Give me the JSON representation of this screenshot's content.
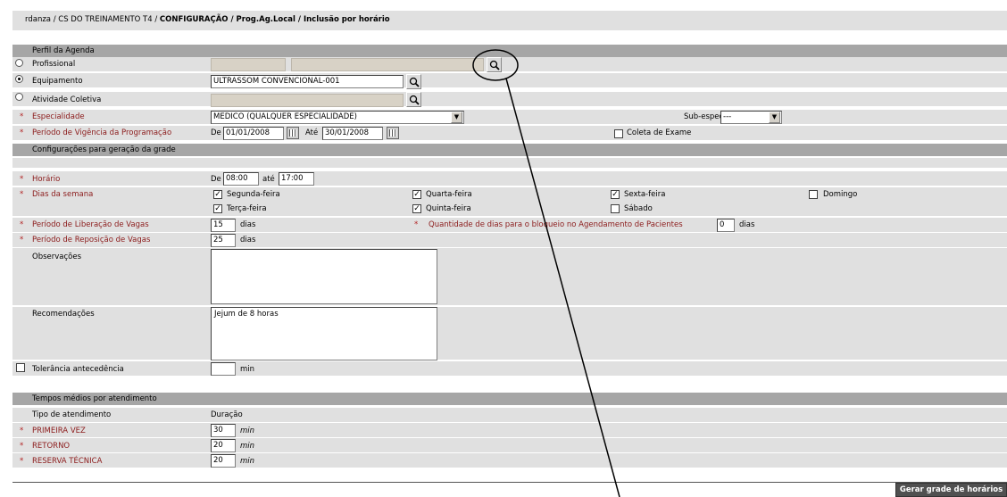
{
  "breadcrumb": {
    "path": "rdanza / CS DO TREINAMENTO T4 / ",
    "current": "CONFIGURAÇÃO / Prog.Ag.Local / Inclusão por horário"
  },
  "perfil": {
    "header": "Perfil da Agenda",
    "profissional_label": "Profissional",
    "equipamento_label": "Equipamento",
    "equipamento_value": "ULTRASSOM CONVENCIONAL-001",
    "atividade_label": "Atividade Coletiva",
    "especialidade_label": "Especialidade",
    "especialidade_value": "MEDICO (QUALQUER ESPECIALIDADE)",
    "subespecial_label": "Sub-especial.",
    "subespecial_value": "---",
    "periodo_label": "Período de Vigência da Programação",
    "de_label": "De",
    "de_value": "01/01/2008",
    "ate_label": "Até",
    "ate_value": "30/01/2008",
    "coleta_label": "Coleta de Exame",
    "selected_radio": "Equipamento"
  },
  "config": {
    "header": "Configurações para geração da grade",
    "horario_label": "Horário",
    "horario_de_label": "De",
    "horario_de": "08:00",
    "horario_ate_label": "até",
    "horario_ate": "17:00",
    "dias_label": "Dias da semana",
    "days": {
      "segunda": "Segunda-feira",
      "terca": "Terça-feira",
      "quarta": "Quarta-feira",
      "quinta": "Quinta-feira",
      "sexta": "Sexta-feira",
      "sabado": "Sábado",
      "domingo": "Domingo"
    },
    "liberacao_label": "Período de Liberação de Vagas",
    "liberacao_value": "15",
    "dias_unit": "dias",
    "bloqueio_label": "Quantidade de dias para o bloqueio no Agendamento de Pacientes",
    "bloqueio_value": "0",
    "reposicao_label": "Período de Reposição de Vagas",
    "reposicao_value": "25",
    "observacoes_label": "Observações",
    "observacoes_value": "",
    "recomendacoes_label": "Recomendações",
    "recomendacoes_value": "Jejum de 8 horas",
    "tolerancia_label": "Tolerância antecedência",
    "tolerancia_value": "",
    "min_unit": "min"
  },
  "tempos": {
    "header": "Tempos médios por atendimento",
    "col_tipo": "Tipo de atendimento",
    "col_duracao": "Duração",
    "rows": [
      {
        "label": "PRIMEIRA VEZ",
        "value": "30"
      },
      {
        "label": "RETORNO",
        "value": "20"
      },
      {
        "label": "RESERVA TÉCNICA",
        "value": "20"
      }
    ]
  },
  "actions": {
    "gerar_label": "Gerar grade de horários"
  },
  "colors": {
    "header_bg": "#a6a6a6",
    "row_bg": "#e0e0e0",
    "required_text": "#8b1a1a",
    "button_bg": "#505050"
  }
}
